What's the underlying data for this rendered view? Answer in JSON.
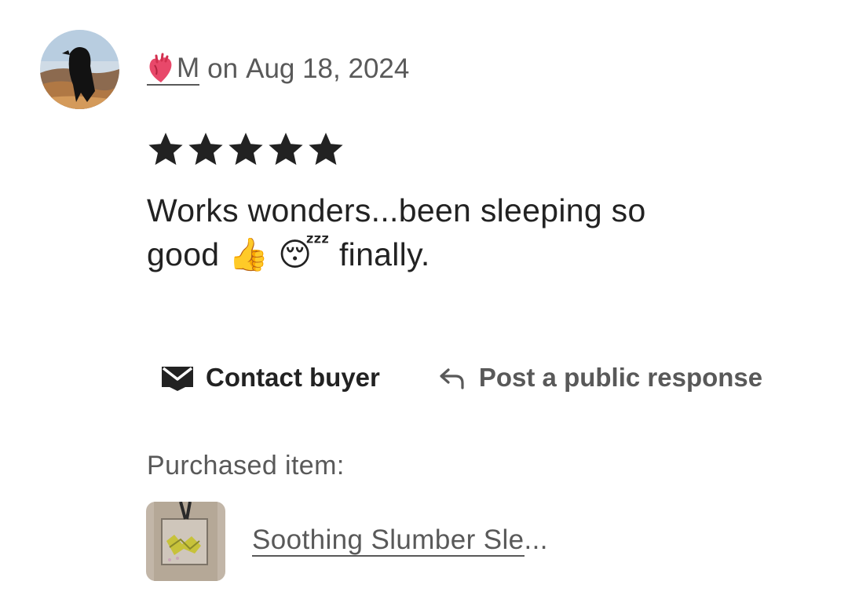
{
  "review": {
    "reviewer_name": "M",
    "date_prefix": "on",
    "date": "Aug 18, 2024",
    "rating": 5,
    "rating_max": 5,
    "text_line1": "Works wonders...been sleeping so",
    "text_line2_start": "good",
    "text_emoji1": "👍",
    "text_emoji2": "😴",
    "text_line2_end": "finally."
  },
  "actions": {
    "contact_label": "Contact buyer",
    "response_label": "Post a public response"
  },
  "purchased": {
    "label": "Purchased item:",
    "item_title": "Soothing Slumber Sle",
    "item_ellipsis": "..."
  },
  "icons": {
    "reviewer_badge": "anatomical-heart-icon",
    "star": "star-icon",
    "contact": "mail-icon",
    "response": "reply-icon"
  },
  "colors": {
    "text_primary": "#222222",
    "text_secondary": "#595959",
    "star": "#222222"
  }
}
